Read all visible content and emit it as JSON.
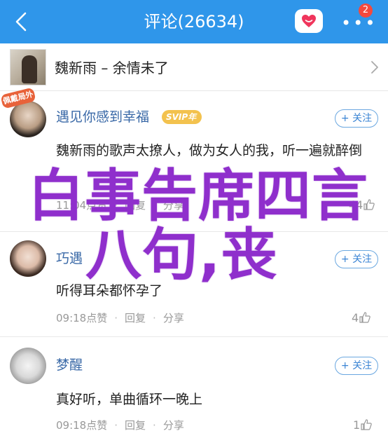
{
  "header": {
    "title": "评论(26634)",
    "badge_count": "2",
    "more_label": "•••"
  },
  "song": {
    "text": "魏新雨 – 余情未了"
  },
  "tag_badge": "佩戴局外",
  "comments": [
    {
      "username": "遇见你感到幸福",
      "vip": "SVIP年",
      "follow": "+ 关注",
      "text": "魏新雨的歌声太撩人，做为女人的我，听一遍就醉倒",
      "time": "11:04",
      "like_label": "点赞",
      "reply": "回复",
      "share": "分享",
      "likes": "44"
    },
    {
      "username": "巧遇",
      "follow": "+ 关注",
      "text": "听得耳朵都怀孕了",
      "time": "09:18",
      "like_label": "点赞",
      "reply": "回复",
      "share": "分享",
      "likes": "4"
    },
    {
      "username": "梦醒",
      "follow": "+ 关注",
      "text": "真好听，单曲循环一晚上",
      "time": "09:18",
      "like_label": "点赞",
      "reply": "回复",
      "share": "分享",
      "likes": "1"
    }
  ],
  "overlay": {
    "line1": "白事告席四言",
    "line2": "八句,丧"
  },
  "colors": {
    "header_bg": "#2f96ea",
    "username": "#3a69a7",
    "overlay": "#8f2fcc",
    "badge": "#f4493d"
  }
}
